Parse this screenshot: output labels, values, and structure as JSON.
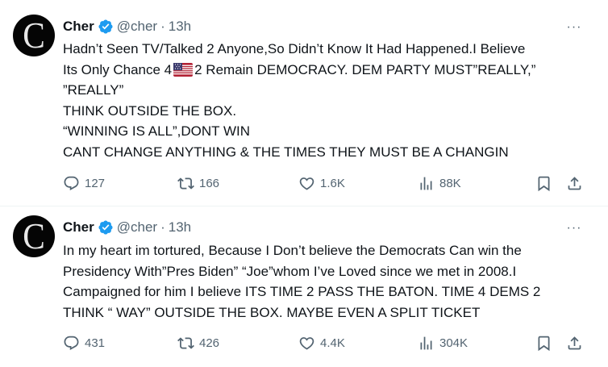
{
  "tweets": [
    {
      "name": "Cher",
      "handle": "@cher",
      "dot": "·",
      "time": "13h",
      "avatar_letter": "C",
      "more": "···",
      "lines": [
        "Hadn’t Seen TV/Talked 2 Anyone,So Didn’t Know It Had Happened.I Believe",
        "Its Only Chance 4",
        "2 Remain DEMOCRACY. DEM PARTY MUST”REALLY,”",
        "”REALLY”",
        "THINK OUTSIDE THE BOX.",
        "“WINNING IS ALL”,DONT WIN",
        "CANT CHANGE ANYTHING & THE TIMES THEY MUST BE A CHANGIN"
      ],
      "flag_icon": "us-flag-icon",
      "replies": "127",
      "reposts": "166",
      "likes": "1.6K",
      "views": "88K"
    },
    {
      "name": "Cher",
      "handle": "@cher",
      "dot": "·",
      "time": "13h",
      "avatar_letter": "C",
      "more": "···",
      "lines": [
        "In my heart im tortured, Because I Don’t believe the Democrats Can win the",
        "Presidency With”Pres Biden” “Joe”whom I’ve Loved since we met in 2008.I",
        "Campaigned for him I believe ITS TIME 2 PASS THE BATON. TIME 4 DEMS 2",
        "THINK “ WAY” OUTSIDE THE BOX. MAYBE EVEN A SPLIT TICKET"
      ],
      "replies": "431",
      "reposts": "426",
      "likes": "4.4K",
      "views": "304K"
    }
  ],
  "colors": {
    "text": "#0f1419",
    "secondary": "#536471",
    "verified": "#1d9bf0",
    "divider": "#eff3f4"
  },
  "icons": [
    "verified-badge-icon",
    "more-icon",
    "reply-icon",
    "repost-icon",
    "like-icon",
    "views-icon",
    "bookmark-icon",
    "share-icon"
  ]
}
